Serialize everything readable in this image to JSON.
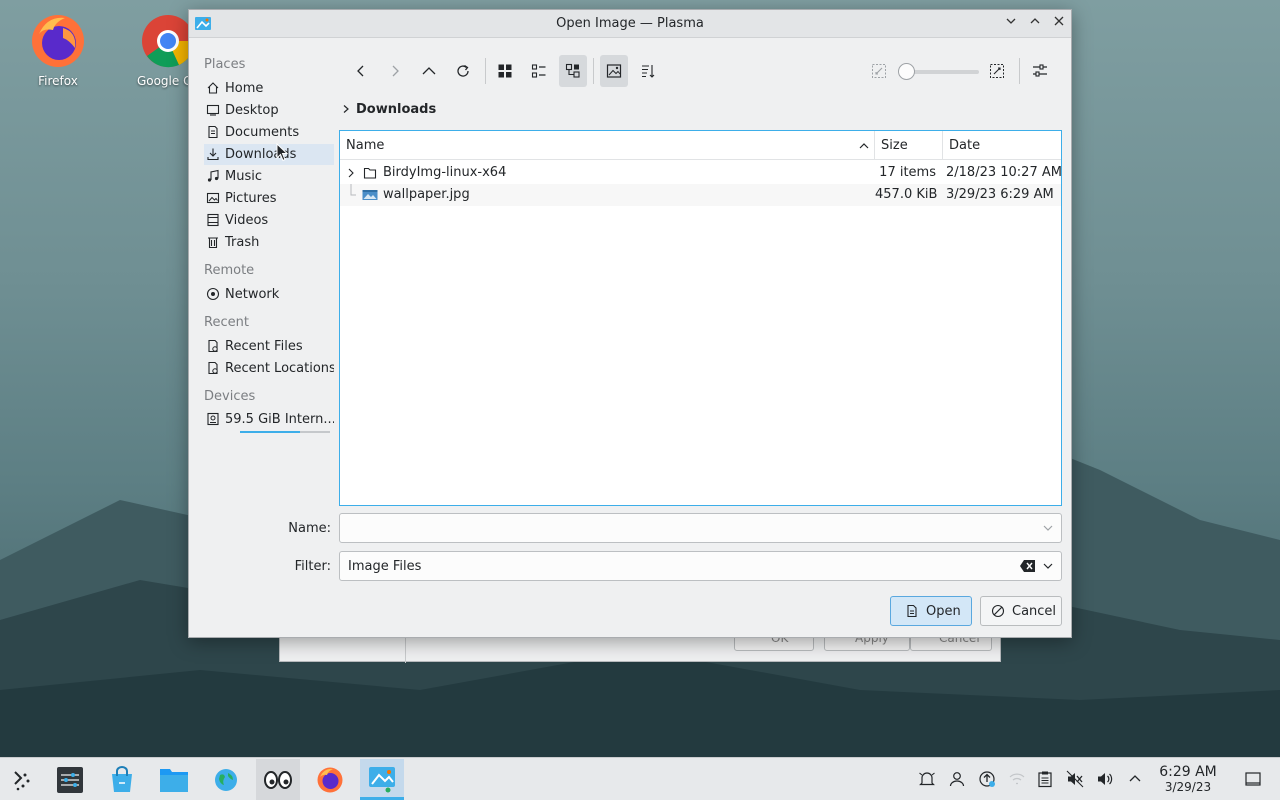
{
  "desktop": {
    "icons": [
      {
        "label": "Firefox"
      },
      {
        "label": "Google Ch"
      }
    ]
  },
  "background_dialog": {
    "ok_label": "OK",
    "apply_label": "Apply",
    "cancel_label": "Cancel"
  },
  "dialog": {
    "title": "Open Image — Plasma",
    "places": {
      "sections": {
        "places": "Places",
        "remote": "Remote",
        "recent": "Recent",
        "devices": "Devices"
      },
      "items": {
        "home": "Home",
        "desktop": "Desktop",
        "documents": "Documents",
        "downloads": "Downloads",
        "music": "Music",
        "pictures": "Pictures",
        "videos": "Videos",
        "trash": "Trash",
        "network": "Network",
        "recent_files": "Recent Files",
        "recent_locations": "Recent Locations",
        "device": "59.5 GiB Intern..."
      }
    },
    "breadcrumb": "Downloads",
    "columns": {
      "name": "Name",
      "size": "Size",
      "date": "Date"
    },
    "rows": [
      {
        "name": "BirdyImg-linux-x64",
        "size": "17 items",
        "date": "2/18/23 10:27 AM",
        "icon": "folder-icon"
      },
      {
        "name": "wallpaper.jpg",
        "size": "457.0 KiB",
        "date": "3/29/23 6:29 AM",
        "icon": "image-file-icon"
      }
    ],
    "name_label": "Name:",
    "name_value": "",
    "filter_label": "Filter:",
    "filter_value": "Image Files",
    "open_label": "Open",
    "cancel_label": "Cancel"
  },
  "taskbar": {
    "time": "6:29 AM",
    "date": "3/29/23"
  },
  "colors": {
    "accent": "#3daee9",
    "selection": "#dbe6f2",
    "window_bg": "#eff0f1"
  }
}
